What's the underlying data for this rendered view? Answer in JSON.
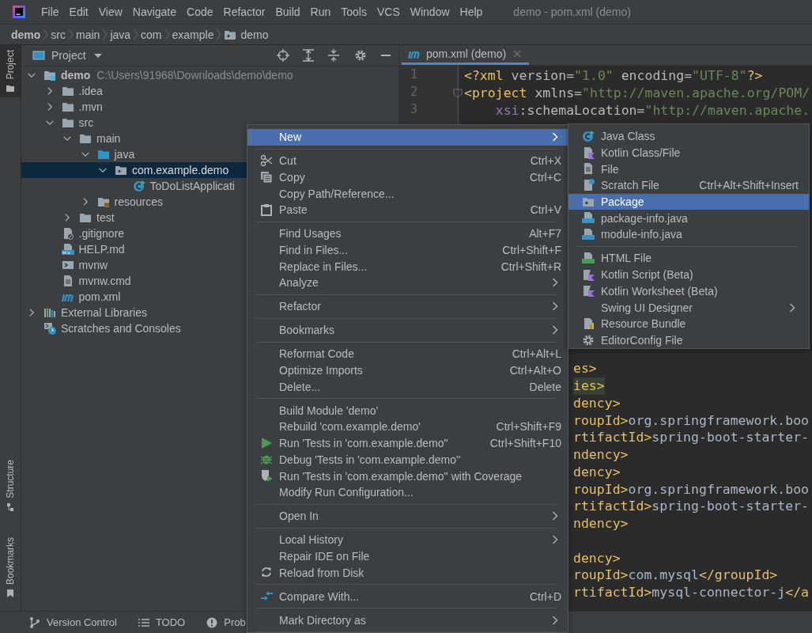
{
  "menu_bar": {
    "items": [
      "File",
      "Edit",
      "View",
      "Navigate",
      "Code",
      "Refactor",
      "Build",
      "Run",
      "Tools",
      "VCS",
      "Window",
      "Help"
    ],
    "title": "demo - pom.xml (demo)"
  },
  "breadcrumb": [
    {
      "label": "demo",
      "kind": "module"
    },
    {
      "label": "src",
      "kind": "dir"
    },
    {
      "label": "main",
      "kind": "dir"
    },
    {
      "label": "java",
      "kind": "dir"
    },
    {
      "label": "com",
      "kind": "dir"
    },
    {
      "label": "example",
      "kind": "dir"
    },
    {
      "label": "demo",
      "kind": "package"
    }
  ],
  "tool_stripe": {
    "top": [
      {
        "label": "Project",
        "selected": true
      }
    ],
    "bottom": [
      {
        "label": "Structure",
        "selected": false
      },
      {
        "label": "Bookmarks",
        "selected": false
      }
    ]
  },
  "project_panel": {
    "title": "Project",
    "tree": [
      {
        "label": "demo",
        "kind": "module",
        "path": "C:\\Users\\91968\\Downloads\\demo\\demo",
        "expanded": true,
        "selected": false,
        "children": [
          {
            "label": ".idea",
            "kind": "folder",
            "expanded": false,
            "selected": false
          },
          {
            "label": ".mvn",
            "kind": "folder",
            "expanded": false,
            "selected": false
          },
          {
            "label": "src",
            "kind": "folder",
            "expanded": true,
            "selected": false,
            "children": [
              {
                "label": "main",
                "kind": "folder",
                "expanded": true,
                "selected": false,
                "children": [
                  {
                    "label": "java",
                    "kind": "source-folder",
                    "expanded": true,
                    "selected": false,
                    "children": [
                      {
                        "label": "com.example.demo",
                        "kind": "package",
                        "expanded": true,
                        "selected": true,
                        "children": [
                          {
                            "label": "ToDoListApplicati",
                            "kind": "java-class",
                            "selected": false
                          }
                        ]
                      }
                    ]
                  },
                  {
                    "label": "resources",
                    "kind": "resources",
                    "expanded": false,
                    "selected": false
                  }
                ]
              },
              {
                "label": "test",
                "kind": "folder",
                "expanded": false,
                "selected": false
              }
            ]
          },
          {
            "label": ".gitignore",
            "kind": "gitignore",
            "selected": false
          },
          {
            "label": "HELP.md",
            "kind": "markdown",
            "selected": false
          },
          {
            "label": "mvnw",
            "kind": "shell",
            "selected": false
          },
          {
            "label": "mvnw.cmd",
            "kind": "cmd",
            "selected": false
          },
          {
            "label": "pom.xml",
            "kind": "maven",
            "selected": false
          }
        ]
      },
      {
        "label": "External Libraries",
        "kind": "libraries",
        "expanded": false,
        "selected": false
      },
      {
        "label": "Scratches and Consoles",
        "kind": "scratches",
        "selected": false
      }
    ]
  },
  "editor": {
    "tabs": [
      {
        "label": "pom.xml (demo)",
        "selected": true
      }
    ],
    "lines": [
      {
        "number": "1",
        "segments": [
          {
            "kind": "tag",
            "text": "<?xml"
          },
          {
            "kind": "attr",
            "text": " version="
          },
          {
            "kind": "value",
            "text": "\"1.0\""
          },
          {
            "kind": "attr",
            "text": " encoding="
          },
          {
            "kind": "value",
            "text": "\"UTF-8\""
          },
          {
            "kind": "tag",
            "text": "?>"
          }
        ]
      },
      {
        "number": "2",
        "segments": [
          {
            "kind": "tag",
            "text": "<project"
          },
          {
            "kind": "attr",
            "text": " xmlns="
          },
          {
            "kind": "value",
            "text": "\"http://maven.apache.org/POM/"
          }
        ]
      },
      {
        "number": "3",
        "segments": [
          {
            "kind": "ns",
            "text": "    xsi"
          },
          {
            "kind": "attr",
            "text": ":schemaLocation="
          },
          {
            "kind": "value",
            "text": "\"http://maven.apache."
          }
        ]
      }
    ],
    "partial_lines": [
      {
        "kind": "code",
        "highlighted": false,
        "segments": [
          {
            "kind": "tag",
            "text": "es>"
          }
        ]
      },
      {
        "kind": "code",
        "highlighted": true,
        "segments": [
          {
            "kind": "tag",
            "text": "ies>"
          }
        ]
      },
      {
        "kind": "code",
        "highlighted": false,
        "segments": [
          {
            "kind": "tag",
            "text": "dency>"
          }
        ]
      },
      {
        "kind": "code",
        "highlighted": false,
        "segments": [
          {
            "kind": "tag",
            "text": "roupId>"
          },
          {
            "kind": "text",
            "text": "org.springframework.boo"
          }
        ]
      },
      {
        "kind": "code",
        "highlighted": false,
        "segments": [
          {
            "kind": "tag",
            "text": "rtifactId>"
          },
          {
            "kind": "text",
            "text": "spring-boot-starter-"
          }
        ]
      },
      {
        "kind": "code",
        "highlighted": false,
        "segments": [
          {
            "kind": "tag",
            "text": "ndency>"
          }
        ]
      },
      {
        "kind": "code",
        "highlighted": false,
        "segments": [
          {
            "kind": "tag",
            "text": "dency>"
          }
        ]
      },
      {
        "kind": "code",
        "highlighted": false,
        "segments": [
          {
            "kind": "tag",
            "text": "roupId>"
          },
          {
            "kind": "text",
            "text": "org.springframework.boo"
          }
        ]
      },
      {
        "kind": "code",
        "highlighted": false,
        "segments": [
          {
            "kind": "tag",
            "text": "rtifactId>"
          },
          {
            "kind": "text",
            "text": "spring-boot-starter-"
          }
        ]
      },
      {
        "kind": "code",
        "highlighted": false,
        "segments": [
          {
            "kind": "tag",
            "text": "ndency>"
          }
        ]
      },
      {
        "kind": "blank"
      },
      {
        "kind": "code",
        "highlighted": false,
        "segments": [
          {
            "kind": "tag",
            "text": "dency>"
          }
        ]
      },
      {
        "kind": "code",
        "highlighted": false,
        "segments": [
          {
            "kind": "tag",
            "text": "roupId>"
          },
          {
            "kind": "text",
            "text": "com.mysql"
          },
          {
            "kind": "tag",
            "text": "</groupId>"
          }
        ]
      },
      {
        "kind": "code",
        "highlighted": false,
        "segments": [
          {
            "kind": "tag",
            "text": "rtifactId>"
          },
          {
            "kind": "text",
            "text": "mysql-connector-j"
          },
          {
            "kind": "tag",
            "text": "</a"
          }
        ]
      }
    ]
  },
  "bottom_bar": [
    {
      "label": "Version Control"
    },
    {
      "label": "TODO"
    },
    {
      "label": "Prob"
    }
  ],
  "context_menu": {
    "items": [
      {
        "kind": "item",
        "label": "New",
        "submenu": true,
        "selected": true
      },
      {
        "kind": "separator"
      },
      {
        "kind": "item",
        "label": "Cut",
        "shortcut": "Ctrl+X",
        "selected": false
      },
      {
        "kind": "item",
        "label": "Copy",
        "shortcut": "Ctrl+C",
        "selected": false
      },
      {
        "kind": "item",
        "label": "Copy Path/Reference...",
        "selected": false
      },
      {
        "kind": "item",
        "label": "Paste",
        "shortcut": "Ctrl+V",
        "selected": false
      },
      {
        "kind": "separator"
      },
      {
        "kind": "item",
        "label": "Find Usages",
        "shortcut": "Alt+F7",
        "selected": false
      },
      {
        "kind": "item",
        "label": "Find in Files...",
        "shortcut": "Ctrl+Shift+F",
        "selected": false
      },
      {
        "kind": "item",
        "label": "Replace in Files...",
        "shortcut": "Ctrl+Shift+R",
        "selected": false
      },
      {
        "kind": "item",
        "label": "Analyze",
        "submenu": true,
        "selected": false
      },
      {
        "kind": "separator"
      },
      {
        "kind": "item",
        "label": "Refactor",
        "submenu": true,
        "selected": false
      },
      {
        "kind": "separator"
      },
      {
        "kind": "item",
        "label": "Bookmarks",
        "submenu": true,
        "selected": false
      },
      {
        "kind": "separator"
      },
      {
        "kind": "item",
        "label": "Reformat Code",
        "shortcut": "Ctrl+Alt+L",
        "selected": false
      },
      {
        "kind": "item",
        "label": "Optimize Imports",
        "shortcut": "Ctrl+Alt+O",
        "selected": false
      },
      {
        "kind": "item",
        "label": "Delete...",
        "shortcut": "Delete",
        "selected": false
      },
      {
        "kind": "separator"
      },
      {
        "kind": "item",
        "label": "Build Module 'demo'",
        "selected": false
      },
      {
        "kind": "item",
        "label": "Rebuild 'com.example.demo'",
        "shortcut": "Ctrl+Shift+F9",
        "selected": false
      },
      {
        "kind": "item",
        "label": "Run 'Tests in 'com.example.demo''",
        "shortcut": "Ctrl+Shift+F10",
        "selected": false
      },
      {
        "kind": "item",
        "label": "Debug 'Tests in 'com.example.demo''",
        "selected": false
      },
      {
        "kind": "item",
        "label": "Run 'Tests in 'com.example.demo'' with Coverage",
        "selected": false
      },
      {
        "kind": "item",
        "label": "Modify Run Configuration...",
        "selected": false
      },
      {
        "kind": "separator"
      },
      {
        "kind": "item",
        "label": "Open In",
        "submenu": true,
        "selected": false
      },
      {
        "kind": "separator"
      },
      {
        "kind": "item",
        "label": "Local History",
        "submenu": true,
        "selected": false
      },
      {
        "kind": "item",
        "label": "Repair IDE on File",
        "selected": false
      },
      {
        "kind": "item",
        "label": "Reload from Disk",
        "selected": false
      },
      {
        "kind": "separator"
      },
      {
        "kind": "item",
        "label": "Compare With...",
        "shortcut": "Ctrl+D",
        "selected": false
      },
      {
        "kind": "separator"
      },
      {
        "kind": "item",
        "label": "Mark Directory as",
        "submenu": true,
        "selected": false
      },
      {
        "kind": "separator"
      }
    ]
  },
  "new_submenu": {
    "items": [
      {
        "kind": "item",
        "label": "Java Class",
        "selected": false
      },
      {
        "kind": "item",
        "label": "Kotlin Class/File",
        "selected": false
      },
      {
        "kind": "item",
        "label": "File",
        "selected": false
      },
      {
        "kind": "item",
        "label": "Scratch File",
        "shortcut": "Ctrl+Alt+Shift+Insert",
        "selected": false
      },
      {
        "kind": "item",
        "label": "Package",
        "selected": true
      },
      {
        "kind": "item",
        "label": "package-info.java",
        "selected": false
      },
      {
        "kind": "item",
        "label": "module-info.java",
        "selected": false
      },
      {
        "kind": "separator"
      },
      {
        "kind": "item",
        "label": "HTML File",
        "selected": false
      },
      {
        "kind": "item",
        "label": "Kotlin Script (Beta)",
        "selected": false
      },
      {
        "kind": "item",
        "label": "Kotlin Worksheet (Beta)",
        "selected": false
      },
      {
        "kind": "item",
        "label": "Swing UI Designer",
        "submenu": true,
        "selected": false
      },
      {
        "kind": "item",
        "label": "Resource Bundle",
        "selected": false
      },
      {
        "kind": "item",
        "label": "EditorConfig File",
        "selected": false
      }
    ]
  }
}
